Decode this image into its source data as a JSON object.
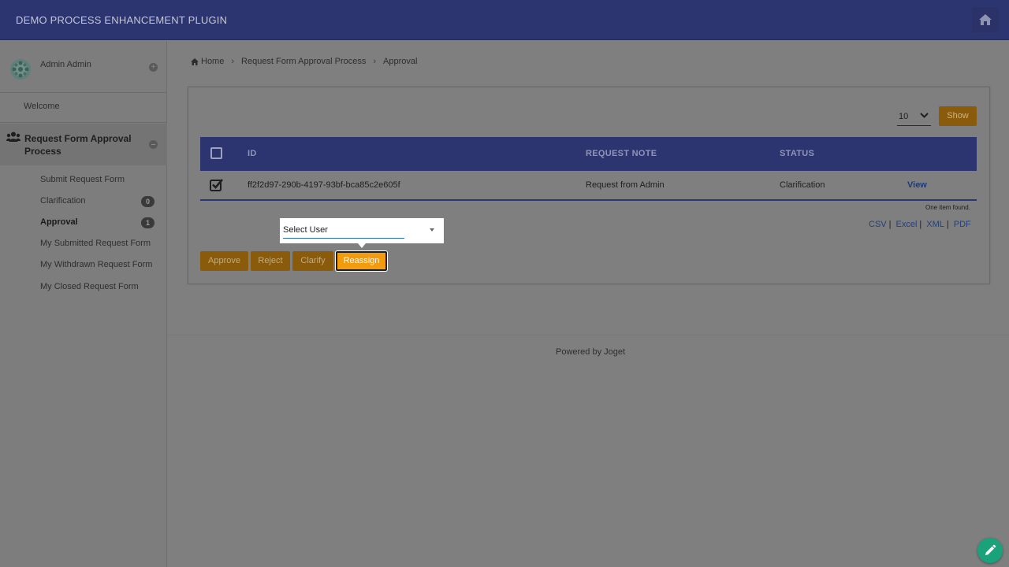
{
  "app": {
    "title": "DEMO PROCESS ENHANCEMENT PLUGIN"
  },
  "colors": {
    "header": "#2c3570",
    "accent": "#f29b0c",
    "fab": "#1aa37a"
  },
  "user": {
    "name": "Admin Admin"
  },
  "sidebar": {
    "welcome": "Welcome",
    "group_label": "Request Form Approval Process",
    "items": [
      {
        "label": "Submit Request Form"
      },
      {
        "label": "Clarification",
        "count": "0"
      },
      {
        "label": "Approval",
        "count": "1"
      },
      {
        "label": "My Submitted Request Form"
      },
      {
        "label": "My Withdrawn Request Form"
      },
      {
        "label": "My Closed Request Form"
      }
    ]
  },
  "breadcrumb": {
    "home": "Home",
    "process": "Request Form Approval Process",
    "current": "Approval"
  },
  "list": {
    "page_size": "10",
    "show_label": "Show",
    "columns": {
      "id": "ID",
      "note": "REQUEST NOTE",
      "status": "STATUS"
    },
    "rows": [
      {
        "id": "ff2f2d97-290b-4197-93bf-bca85c2e605f",
        "note": "Request from Admin",
        "status": "Clarification",
        "action": "View"
      }
    ],
    "found": "One item found.",
    "exports": [
      "CSV",
      "Excel",
      "XML",
      "PDF"
    ]
  },
  "reassign_popup": {
    "select_value": "Select User"
  },
  "actions": {
    "approve": "Approve",
    "reject": "Reject",
    "clarify": "Clarify",
    "reassign": "Reassign"
  },
  "footer": {
    "text": "Powered by Joget"
  }
}
